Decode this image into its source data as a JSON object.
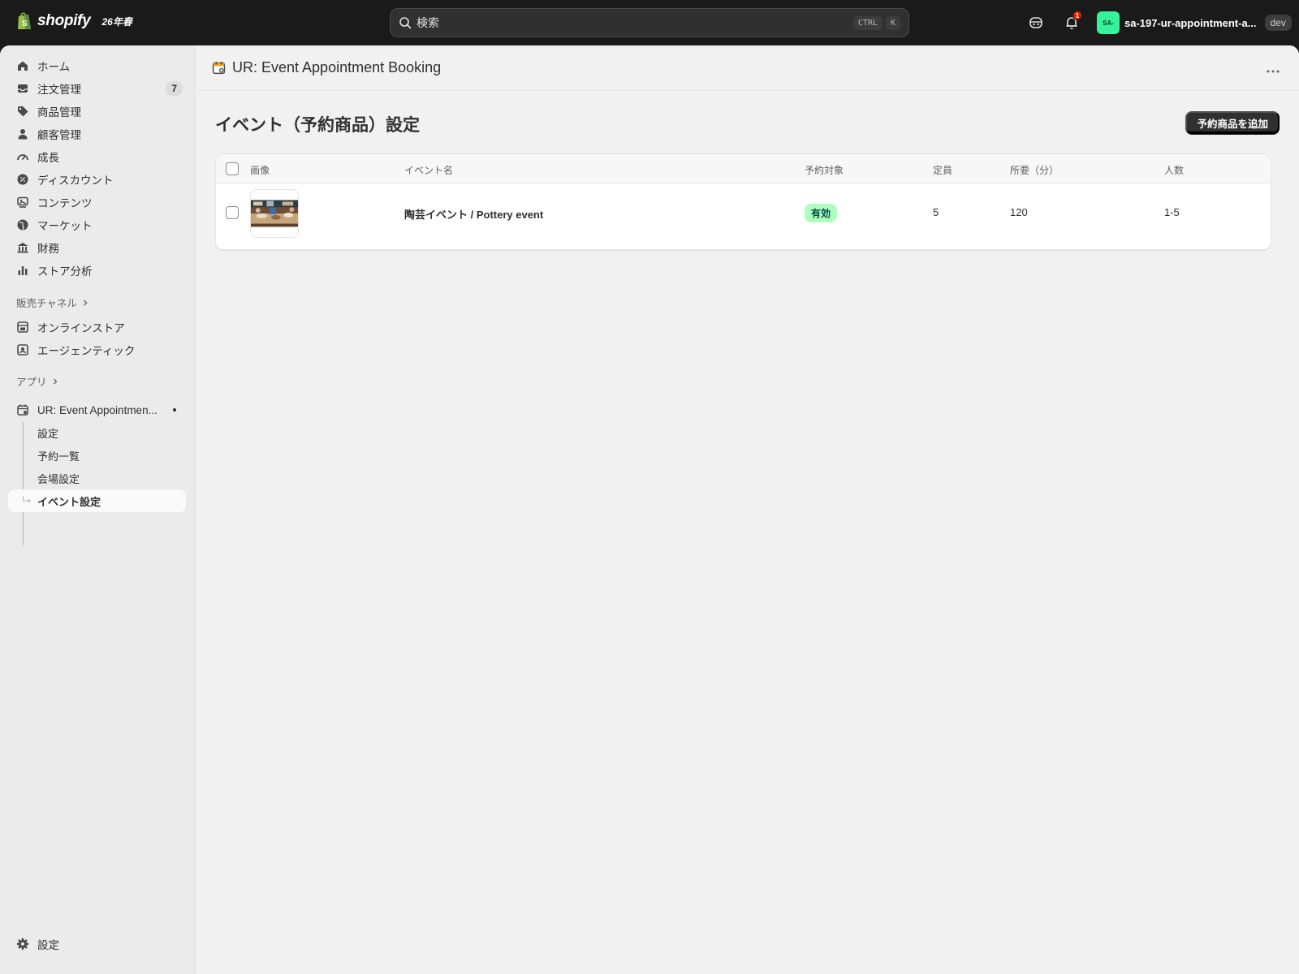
{
  "topbar": {
    "logo_text": "shopify",
    "edition": "26年春",
    "search_placeholder": "検索",
    "shortcut_keys": [
      "CTRL",
      "K"
    ],
    "notification_count": "1",
    "account_initials": "SA-",
    "account_name": "sa-197-ur-appointment-a...",
    "env_badge": "dev",
    "icons": [
      "search-icon",
      "sidekick-icon",
      "bell-icon"
    ]
  },
  "sidebar": {
    "items": [
      {
        "label": "ホーム",
        "icon": "home-icon"
      },
      {
        "label": "注文管理",
        "icon": "inbox-icon",
        "count": "7"
      },
      {
        "label": "商品管理",
        "icon": "tag-icon"
      },
      {
        "label": "顧客管理",
        "icon": "person-icon"
      },
      {
        "label": "成長",
        "icon": "gauge-icon"
      },
      {
        "label": "ディスカウント",
        "icon": "discount-icon"
      },
      {
        "label": "コンテンツ",
        "icon": "content-icon"
      },
      {
        "label": "マーケット",
        "icon": "globe-icon"
      },
      {
        "label": "財務",
        "icon": "bank-icon"
      },
      {
        "label": "ストア分析",
        "icon": "bar-chart-icon"
      }
    ],
    "sales_channels_heading": "販売チャネル",
    "channels": [
      {
        "label": "オンラインストア",
        "icon": "store-icon"
      },
      {
        "label": "エージェンティック",
        "icon": "agentic-icon"
      }
    ],
    "apps_heading": "アプリ",
    "app": {
      "label": "UR: Event Appointmen...",
      "icon": "calendar-icon"
    },
    "app_subitems": [
      "設定",
      "予約一覧",
      "会場設定",
      "イベント設定"
    ],
    "settings_label": "設定"
  },
  "main": {
    "app_title": "UR: Event Appointment Booking",
    "page_title": "イベント（予約商品）設定",
    "add_button": "予約商品を追加",
    "columns": [
      "画像",
      "イベント名",
      "予約対象",
      "定員",
      "所要（分）",
      "人数"
    ],
    "rows": [
      {
        "image": "pottery-thumbnail",
        "name": "陶芸イベント / Pottery event",
        "status": "有効",
        "capacity": "5",
        "duration": "120",
        "people": "1-5"
      }
    ]
  },
  "colors": {
    "topbar_bg": "#1a1a1a",
    "page_bg": "#f1f1f1",
    "primary_button": "#303030",
    "badge_success_bg": "#affebf",
    "badge_success_text": "#014b40",
    "avatar_bg": "#36f29a"
  }
}
